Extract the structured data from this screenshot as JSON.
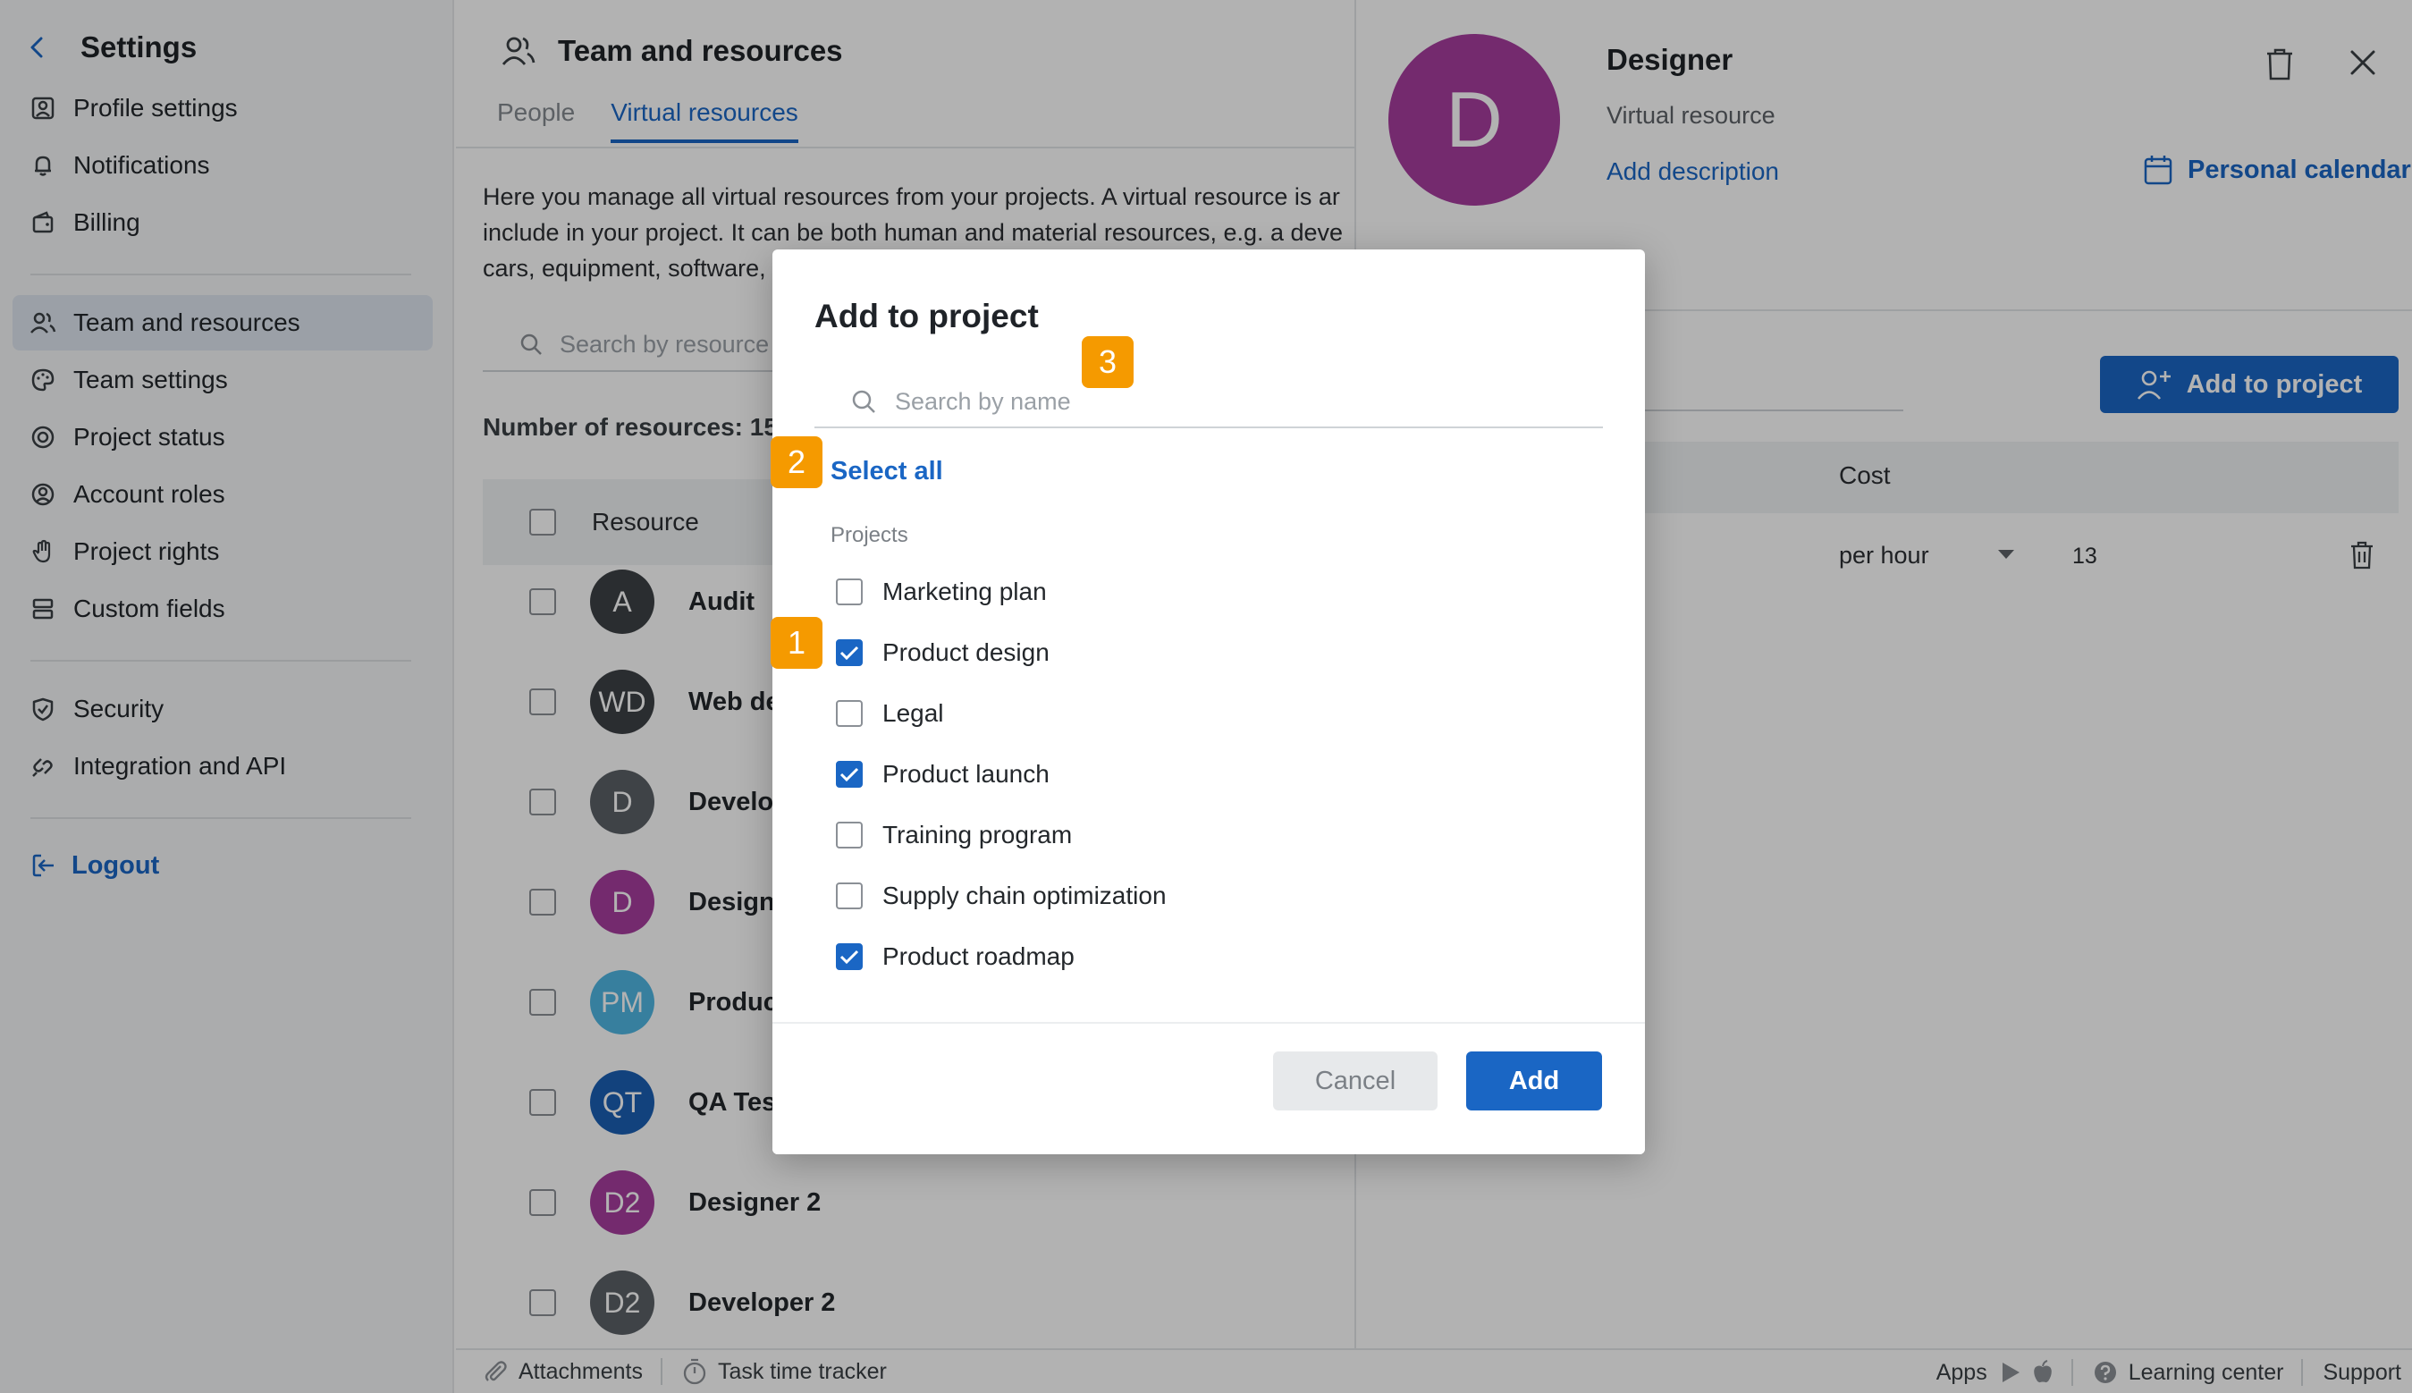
{
  "sidebar": {
    "title": "Settings",
    "items": [
      {
        "label": "Profile settings"
      },
      {
        "label": "Notifications"
      },
      {
        "label": "Billing"
      },
      {
        "label": "Team and resources"
      },
      {
        "label": "Team settings"
      },
      {
        "label": "Project status"
      },
      {
        "label": "Account roles"
      },
      {
        "label": "Project rights"
      },
      {
        "label": "Custom fields"
      },
      {
        "label": "Security"
      },
      {
        "label": "Integration and API"
      }
    ],
    "logout": "Logout"
  },
  "main": {
    "title": "Team and resources",
    "tabs": [
      {
        "label": "People"
      },
      {
        "label": "Virtual resources"
      }
    ],
    "intro": [
      "Here you manage all virtual resources from your projects. A virtual resource is ar",
      "include in your project. It can be both human and material resources, e.g. a deve",
      "cars, equipment, software,"
    ],
    "search_placeholder": "Search by resource",
    "count_label": "Number of resources: 15",
    "column_resource": "Resource",
    "rows": [
      {
        "initials": "A",
        "name": "Audit",
        "color": "#3d4145"
      },
      {
        "initials": "WD",
        "name": "Web des",
        "color": "#3d4145"
      },
      {
        "initials": "D",
        "name": "Develop",
        "color": "#5b6066"
      },
      {
        "initials": "D",
        "name": "Designe",
        "color": "#a63d9e"
      },
      {
        "initials": "PM",
        "name": "Product",
        "color": "#4fb6e3"
      },
      {
        "initials": "QT",
        "name": "QA Test",
        "color": "#1a5fb4"
      },
      {
        "initials": "D2",
        "name": "Designer 2",
        "color": "#a63d9e"
      },
      {
        "initials": "D2",
        "name": "Developer 2",
        "color": "#5b6066"
      }
    ]
  },
  "detail": {
    "initial": "D",
    "name": "Designer",
    "subtitle": "Virtual resource",
    "add_description": "Add description",
    "personal_calendar": "Personal calendar",
    "add_to_project": "Add to project",
    "column_cost": "Cost",
    "rate_unit": "per hour",
    "rate_value": "13"
  },
  "footer": {
    "attachments": "Attachments",
    "task_time_tracker": "Task time tracker",
    "apps": "Apps",
    "learning_center": "Learning center",
    "support": "Support"
  },
  "modal": {
    "title": "Add to project",
    "search_placeholder": "Search by name",
    "select_all": "Select all",
    "section_label": "Projects",
    "projects": [
      {
        "label": "Marketing plan",
        "checked": false
      },
      {
        "label": "Product design",
        "checked": true
      },
      {
        "label": "Legal",
        "checked": false
      },
      {
        "label": "Product launch",
        "checked": true
      },
      {
        "label": "Training program",
        "checked": false
      },
      {
        "label": "Supply chain optimization",
        "checked": false
      },
      {
        "label": "Product roadmap",
        "checked": true
      }
    ],
    "cancel": "Cancel",
    "add": "Add"
  },
  "markers": [
    "1",
    "2",
    "3"
  ],
  "colors": {
    "accent": "#1a66c4",
    "marker": "#f59a00",
    "avatar_designer": "#a63d9e"
  }
}
